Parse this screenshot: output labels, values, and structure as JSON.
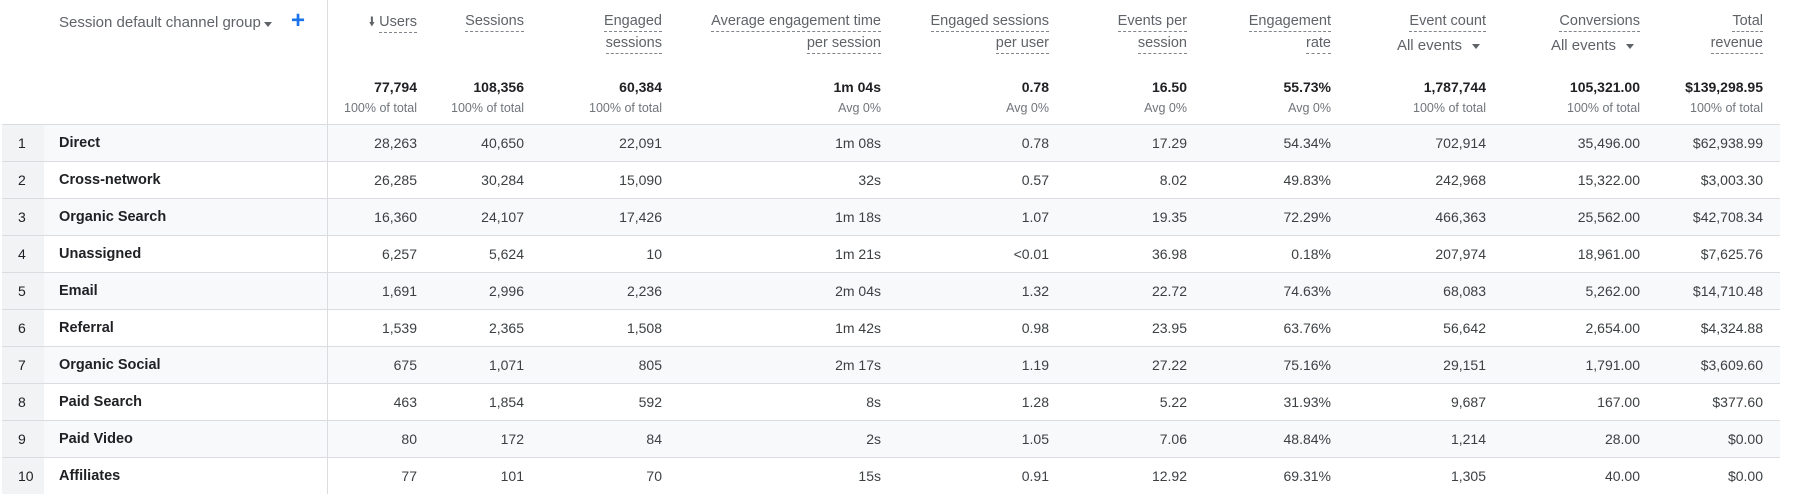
{
  "dimension": {
    "label": "Session default channel group",
    "dropdown_icon": "caret-down-icon",
    "add_icon": "plus-icon"
  },
  "columns": [
    {
      "key": "users",
      "line1": "Users",
      "line2": "",
      "sorted": "desc",
      "total": "77,794",
      "sub": "100% of total"
    },
    {
      "key": "sessions",
      "line1": "Sessions",
      "line2": "",
      "total": "108,356",
      "sub": "100% of total"
    },
    {
      "key": "engaged_sessions",
      "line1": "Engaged",
      "line2": "sessions",
      "total": "60,384",
      "sub": "100% of total"
    },
    {
      "key": "avg_engagement_time",
      "line1": "Average engagement time",
      "line2": "per session",
      "total": "1m 04s",
      "sub": "Avg 0%"
    },
    {
      "key": "engaged_sessions_per_user",
      "line1": "Engaged sessions",
      "line2": "per user",
      "total": "0.78",
      "sub": "Avg 0%"
    },
    {
      "key": "events_per_session",
      "line1": "Events per",
      "line2": "session",
      "total": "16.50",
      "sub": "Avg 0%"
    },
    {
      "key": "engagement_rate",
      "line1": "Engagement",
      "line2": "rate",
      "total": "55.73%",
      "sub": "Avg 0%"
    },
    {
      "key": "event_count",
      "line1": "Event count",
      "selector": "All events",
      "total": "1,787,744",
      "sub": "100% of total"
    },
    {
      "key": "conversions",
      "line1": "Conversions",
      "selector": "All events",
      "total": "105,321.00",
      "sub": "100% of total"
    },
    {
      "key": "total_revenue",
      "line1": "Total",
      "line2": "revenue",
      "total": "$139,298.95",
      "sub": "100% of total"
    }
  ],
  "rows": [
    {
      "index": "1",
      "name": "Direct",
      "values": [
        "28,263",
        "40,650",
        "22,091",
        "1m 08s",
        "0.78",
        "17.29",
        "54.34%",
        "702,914",
        "35,496.00",
        "$62,938.99"
      ]
    },
    {
      "index": "2",
      "name": "Cross-network",
      "values": [
        "26,285",
        "30,284",
        "15,090",
        "32s",
        "0.57",
        "8.02",
        "49.83%",
        "242,968",
        "15,322.00",
        "$3,003.30"
      ]
    },
    {
      "index": "3",
      "name": "Organic Search",
      "values": [
        "16,360",
        "24,107",
        "17,426",
        "1m 18s",
        "1.07",
        "19.35",
        "72.29%",
        "466,363",
        "25,562.00",
        "$42,708.34"
      ]
    },
    {
      "index": "4",
      "name": "Unassigned",
      "values": [
        "6,257",
        "5,624",
        "10",
        "1m 21s",
        "<0.01",
        "36.98",
        "0.18%",
        "207,974",
        "18,961.00",
        "$7,625.76"
      ]
    },
    {
      "index": "5",
      "name": "Email",
      "values": [
        "1,691",
        "2,996",
        "2,236",
        "2m 04s",
        "1.32",
        "22.72",
        "74.63%",
        "68,083",
        "5,262.00",
        "$14,710.48"
      ]
    },
    {
      "index": "6",
      "name": "Referral",
      "values": [
        "1,539",
        "2,365",
        "1,508",
        "1m 42s",
        "0.98",
        "23.95",
        "63.76%",
        "56,642",
        "2,654.00",
        "$4,324.88"
      ]
    },
    {
      "index": "7",
      "name": "Organic Social",
      "values": [
        "675",
        "1,071",
        "805",
        "2m 17s",
        "1.19",
        "27.22",
        "75.16%",
        "29,151",
        "1,791.00",
        "$3,609.60"
      ]
    },
    {
      "index": "8",
      "name": "Paid Search",
      "values": [
        "463",
        "1,854",
        "592",
        "8s",
        "1.28",
        "5.22",
        "31.93%",
        "9,687",
        "167.00",
        "$377.60"
      ]
    },
    {
      "index": "9",
      "name": "Paid Video",
      "values": [
        "80",
        "172",
        "84",
        "2s",
        "1.05",
        "7.06",
        "48.84%",
        "1,214",
        "28.00",
        "$0.00"
      ]
    },
    {
      "index": "10",
      "name": "Affiliates",
      "values": [
        "77",
        "101",
        "70",
        "15s",
        "0.91",
        "12.92",
        "69.31%",
        "1,305",
        "40.00",
        "$0.00"
      ]
    }
  ]
}
